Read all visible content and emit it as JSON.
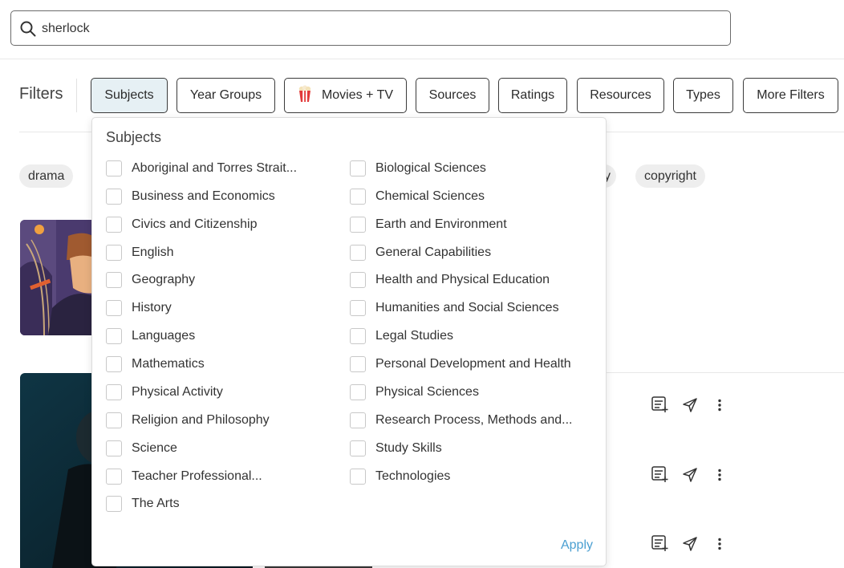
{
  "search": {
    "value": "sherlock"
  },
  "filters": {
    "label": "Filters",
    "buttons": [
      "Subjects",
      "Year Groups",
      "Movies + TV",
      "Sources",
      "Ratings",
      "Resources",
      "Types",
      "More Filters"
    ]
  },
  "tags": {
    "left": "drama",
    "partial": "y",
    "right": "copyright"
  },
  "dropdown": {
    "title": "Subjects",
    "left_options": [
      "Aboriginal and Torres Strait...",
      "Business and Economics",
      "Civics and Citizenship",
      "English",
      "Geography",
      "History",
      "Languages",
      "Mathematics",
      "Physical Activity",
      "Religion and Philosophy",
      "Science",
      "Teacher Professional...",
      "The Arts"
    ],
    "right_options": [
      "Biological Sciences",
      "Chemical Sciences",
      "Earth and Environment",
      "General Capabilities",
      "Health and Physical Education",
      "Humanities and Social Sciences",
      "Legal Studies",
      "Personal Development and Health",
      "Physical Sciences",
      "Research Process, Methods and...",
      "Study Skills",
      "Technologies"
    ],
    "apply": "Apply"
  },
  "colors": {
    "accent": "#4a9fd1",
    "active_filter_bg": "#e6f0f4"
  }
}
